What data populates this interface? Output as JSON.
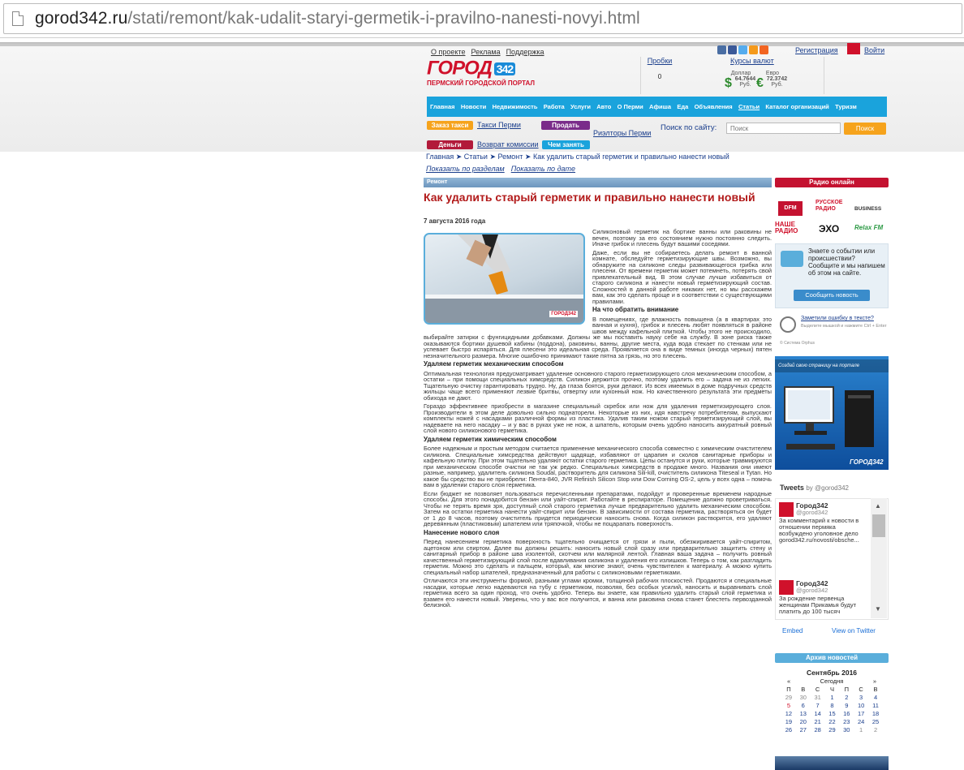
{
  "browser": {
    "url_host": "gorod342.ru",
    "url_path": "/stati/remont/kak-udalit-staryi-germetik-i-pravilno-nanesti-novyi.html"
  },
  "header": {
    "top_links": [
      "О проекте",
      "Реклама",
      "Поддержка"
    ],
    "logo": {
      "name": "ГОРОД",
      "badge": "342",
      "tagline": "ПЕРМСКИЙ ГОРОДСКОЙ ПОРТАЛ"
    },
    "probki": {
      "label": "Пробки",
      "value": "0"
    },
    "kursy": {
      "label": "Курсы валют",
      "usd_label": "Доллар",
      "usd_value": "64.7644",
      "usd_unit": "Руб.",
      "eur_label": "Евро",
      "eur_value": "72.3742",
      "eur_unit": "Руб."
    },
    "register": "Регистрация",
    "login": "Войти"
  },
  "nav": [
    "Главная",
    "Новости",
    "Недвижимость",
    "Работа",
    "Услуги",
    "Авто",
    "О Перми",
    "Афиша",
    "Еда",
    "Объявления",
    "Статьи",
    "Каталог организаций",
    "Туризм"
  ],
  "subnav": {
    "taxi_pill": "Заказ такси",
    "taxi_link": "Такси Перми",
    "sell_pill": "Продать",
    "realtors_link": "Риэлторы Перми",
    "money_pill": "Деньги",
    "borrow_pill": "Чем занять",
    "commission_link": "Возврат комиссии"
  },
  "search": {
    "label": "Поиск по сайту:",
    "placeholder": "Поиск",
    "button": "Поиск"
  },
  "breadcrumb": "Главная ➤ Статьи ➤ Ремонт ➤ Как удалить старый герметик и правильно нанести новый",
  "sort_links": [
    "Показать по разделам",
    "Показать по дате"
  ],
  "article": {
    "rubric": "Ремонт",
    "title": "Как удалить старый герметик и правильно нанести новый",
    "date": "7 августа 2016 года",
    "image_watermark": "ГОРОД342",
    "p1": "Силиконовый герметик на бортике ванны или раковины не вечен, поэтому за его состоянием нужно постоянно следить. Иначе грибок и плесень будут вашими соседями.",
    "p2": "Даже, если вы не собираетесь делать ремонт в ванной комнате, обследуйте герметизирующие швы. Возможно, вы обнаружите на силиконе следы развивающегося грибка или плесени. От времени герметик может потемнеть, потерять свой привлекательный вид. В этом случае лучше избавиться от старого силикона и нанести новый герметизирующий состав. Сложностей в данной работе никаких нет, но мы расскажем вам, как это сделать проще и в соответствии с существующими правилами.",
    "h1": "На что обратить внимание",
    "p3": "В помещениях, где влажность повышена (а в квартирах это ванная и кухня), грибок и плесень любят появляться в районе швов между кафельной плиткой. Чтобы этого не происходило, выбирайте затирки с фунгицидными добавками. Должны же мы поставить науку себе на службу. В зоне риска также оказываются бортики душевой кабины (поддона), раковины, ванны, другие места, куда вода стекает по стенкам или не успевает быстро испаряться. Для плесени это идеальная среда. Проявляется она в виде темных (иногда черных) пятен незначительного размера. Многие ошибочно принимают такие пятна за грязь, но это плесень.",
    "h2": "Удаляем герметик механическим способом",
    "p4": "Оптимальная технология предусматривает удаление основного старого герметизирующего слоя механическим способом, а остатки – при помощи специальных химсредств. Силикон держится прочно, поэтому удалить его – задача не из легких. Тщательную очистку гарантировать трудно. Ну, да глаза боятся, руки делают. Из всех имеемых в доме подручных средств жильцы чаще всего применяют лезвие бритвы, отвертку или кухонный нож. Но качественного результата эти предметы обихода не дают.",
    "p5": "Гораздо эффективнее приобрести в магазине специальный скребок или нож для удаления герметизирующего слоя. Производители в этом деле довольно сильно поднаторели. Некоторые из них, идя навстречу потребителям, выпускают комплекты ножей с насадками различной формы из пластика. Удалив таким ножом старый герметизирующий слой, вы надеваете на него насадку – и у вас в руках уже не нож, а шпатель, которым очень удобно наносить аккуратный ровный слой нового силиконового герметика.",
    "h3": "Удаляем герметик химическим способом",
    "p6": "Более надежным и простым методом считается применение механического способа совместно с химическим очистителем силикона. Специальные химсредства действуют щадяще, избавляют от царапин и сколов санитарные приборы и кафельную плитку. При этом тщательно удаляют остатки старого герметика. Цепы останутся и руки, которые травмируются при механическом способе очистки не так уж редко. Специальных химсредств в продаже много. Названия они имеют разные, например, удалитель силикона Soudal, растворитель для силикона Sili-kill, очиститель силикона Titeseal и Tytan. Но какое бы средство вы не приобрели: Пента-840, JVR Refinish Silicon Stop или Dow Corning OS-2, цель у всех одна – помочь вам в удалении старого слоя герметика.",
    "p7": "Если бюджет не позволяет пользоваться перечисленными препаратами, подойдут и проверенные временем народные способы. Для этого понадобится бензин или уайт-спирит. Работайте в респираторе. Помещение должно проветриваться. Чтобы не терять время зря, доступный слой старого герметика лучше предварительно удалить механическим способом. Затем на остатки герметика нанести уайт-спирит или бензин. В зависимости от состава герметика, растворяться он будет от 1 до 8 часов, поэтому очиститель придется периодически наносить снова. Когда силикон растворится, его удаляют деревянным (пластиковым) шпателем или тряпочкой, чтобы не поцарапать поверхность.",
    "h4": "Нанесение нового слоя",
    "p8": "Перед нанесением герметика поверхность тщательно очищается от грязи и пыли, обезжиривается уайт-спиритом, ацетоном или спиртом. Далее вы должны решить: наносить новый слой сразу или предварительно защитить стену и санитарный прибор в районе шва изолентой, скотчем или малярной лентой. Главная ваша задача – получить ровный качественный герметизирующий слой после вдавливания силикона и удаления его излишков. Теперь о том, как разгладить герметик. Можно это сделать и пальцем, который, как многие знают, очень чувствителен к материалу. А можно купить специальный набор шпателей, предназначенный для работы с силиконовыми герметиками.",
    "p9": "Отличаются эти инструменты формой, разными углами кромки, толщиной рабочих плоскостей. Продаются и специальные насадки, которые легко надеваются на тубу с герметиком, позволяя, без особых усилий, наносить и выравнивать слой герметика всего за один проход, что очень удобно. Теперь вы знаете, как правильно удалить старый слой герметика и взамен его нанести новый. Уверены, что у вас все получится, и ванна или раковина снова станет блестеть первозданной белизной."
  },
  "sidebar": {
    "radio_header": "Радио онлайн",
    "radio_logos": [
      "DFM",
      "РУССКОЕ РАДИО",
      "BUSINESS",
      "НАШЕ РАДИО",
      "ЭХО",
      "Relax FM"
    ],
    "event_text": "Знаете о событии или происшествии? Сообщите и мы напишем об этом на сайте.",
    "event_button": "Сообщить новость",
    "error_title": "Заметили ошибку в тексте?",
    "error_hint": "Выделите мышкой и нажмите Ctrl + Enter",
    "error_credit": "© Система Orphus",
    "banner_text": "Создай свою страницу на портале",
    "banner_logo": "ГОРОД342",
    "tweets_title": "Tweets",
    "tweets_by": "by @gorod342",
    "tweets": [
      {
        "name": "Город342",
        "handle": "@gorod342",
        "text": "За комментарий к новости в отношении пермяка возбуждено уголовное дело gorod342.ru/novosti/obsche..."
      },
      {
        "name": "Город342",
        "handle": "@gorod342",
        "text": "За рождение первенца женщинам Прикамья будут платить до 100 тысяч"
      }
    ],
    "embed": "Embed",
    "view_on_twitter": "View on Twitter",
    "archive_header": "Архив новостей",
    "calendar": {
      "month": "Сентябрь 2016",
      "prev": "«",
      "today": "Сегодня",
      "next": "»",
      "weekdays": [
        "П",
        "В",
        "С",
        "Ч",
        "П",
        "С",
        "В"
      ],
      "weeks": [
        [
          "29",
          "30",
          "31",
          "1",
          "2",
          "3",
          "4"
        ],
        [
          "5",
          "6",
          "7",
          "8",
          "9",
          "10",
          "11"
        ],
        [
          "12",
          "13",
          "14",
          "15",
          "16",
          "17",
          "18"
        ],
        [
          "19",
          "20",
          "21",
          "22",
          "23",
          "24",
          "25"
        ],
        [
          "26",
          "27",
          "28",
          "29",
          "30",
          "1",
          "2"
        ]
      ]
    }
  },
  "colors": {
    "accent": "#1aa3dc",
    "brand_red": "#d0112b",
    "title_red": "#b21a1a",
    "link": "#1a3e8c"
  }
}
